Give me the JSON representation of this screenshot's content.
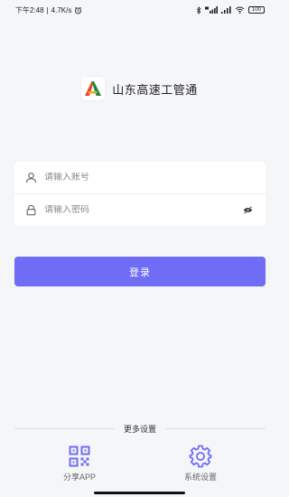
{
  "status_bar": {
    "time_text": "下午2:48",
    "separator": "|",
    "network_speed": "4.7K/s",
    "icons": [
      "alarm-icon",
      "bluetooth-icon",
      "cellular-4g-icon",
      "cellular-icon",
      "wifi-icon"
    ],
    "battery_level": "100"
  },
  "app": {
    "name": "山东高速工管通",
    "logo_colors": [
      "#e8452c",
      "#f5a623",
      "#1a8a3d"
    ]
  },
  "login_form": {
    "account_placeholder": "请输入账号",
    "account_value": "",
    "password_placeholder": "请输入密码",
    "password_value": "",
    "account_icon": "user-icon",
    "password_icon": "lock-icon",
    "password_visibility_icon": "eye-off-icon"
  },
  "login_button": {
    "label": "登录",
    "color": "#6f6cf5"
  },
  "more_settings": {
    "label": "更多设置"
  },
  "bottom_actions": [
    {
      "label": "分享APP",
      "icon": "qr-code-icon"
    },
    {
      "label": "系统设置",
      "icon": "gear-icon"
    }
  ],
  "colors": {
    "accent": "#6f6cf5",
    "background": "#f5f6f8"
  }
}
